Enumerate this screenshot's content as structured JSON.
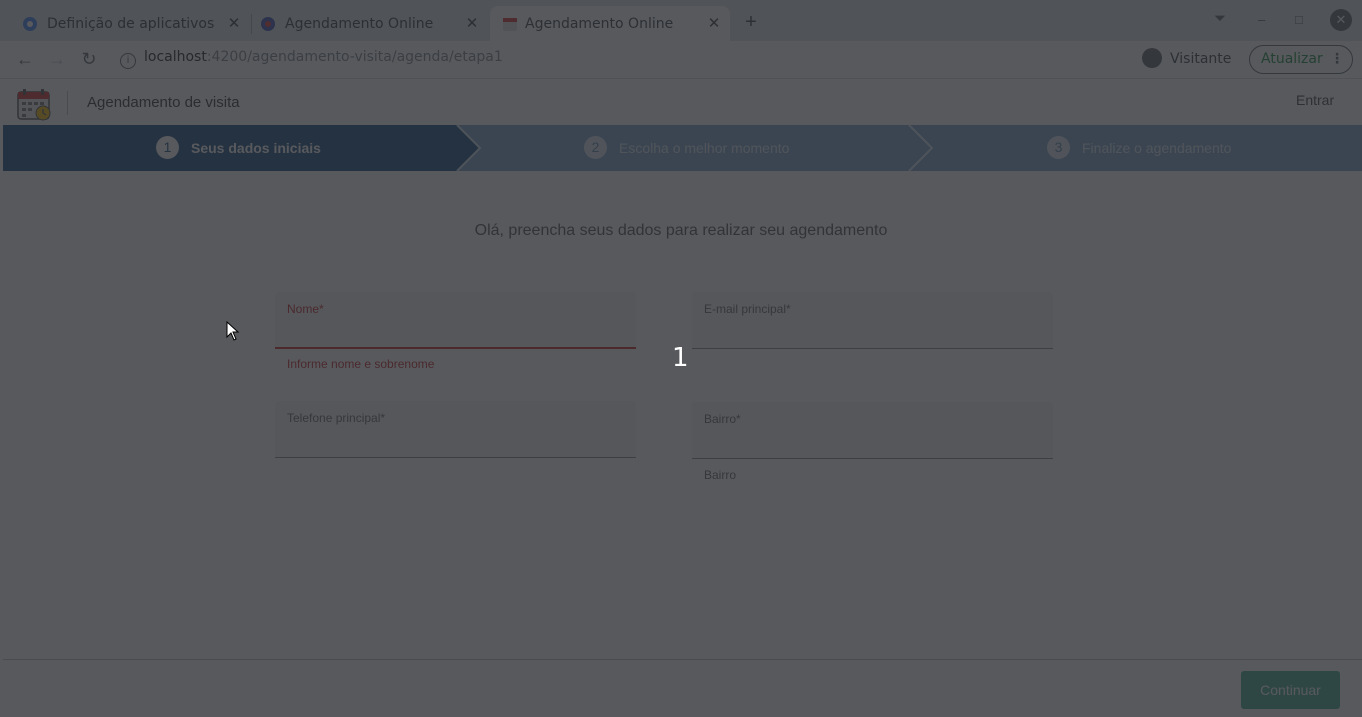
{
  "browser": {
    "tabs": [
      {
        "title": "Definição de aplicativos",
        "active": false
      },
      {
        "title": "Agendamento Online",
        "active": false
      },
      {
        "title": "Agendamento Online",
        "active": true
      }
    ],
    "new_tab_label": "+",
    "url_host": "localhost",
    "url_path": ":4200/agendamento-visita/agenda/etapa1",
    "profile_label": "Visitante",
    "update_label": "Atualizar"
  },
  "app": {
    "title": "Agendamento de visita",
    "login_label": "Entrar"
  },
  "stepper": {
    "steps": [
      {
        "number": "1",
        "label": "Seus dados iniciais",
        "state": "current"
      },
      {
        "number": "2",
        "label": "Escolha o melhor momento",
        "state": "upcoming"
      },
      {
        "number": "3",
        "label": "Finalize o agendamento",
        "state": "upcoming"
      }
    ]
  },
  "form": {
    "heading": "Olá, preencha seus dados para realizar seu agendamento",
    "nome": {
      "label": "Nome*",
      "value": "",
      "hint": "Informe nome e sobrenome",
      "error": true
    },
    "email": {
      "label": "E-mail principal*",
      "value": ""
    },
    "telefone": {
      "label": "Telefone principal*",
      "value": ""
    },
    "bairro": {
      "label": "Bairro*",
      "value": "",
      "hint": "Bairro"
    }
  },
  "footer": {
    "continue_label": "Continuar"
  },
  "overlay": {
    "marker": "1"
  },
  "colors": {
    "step_current": "#1f4f7f",
    "step_upcoming": "#7fa6c8",
    "error": "#c62828",
    "primary_button": "#4caf8f",
    "overlay": "rgba(40,42,48,0.78)"
  }
}
